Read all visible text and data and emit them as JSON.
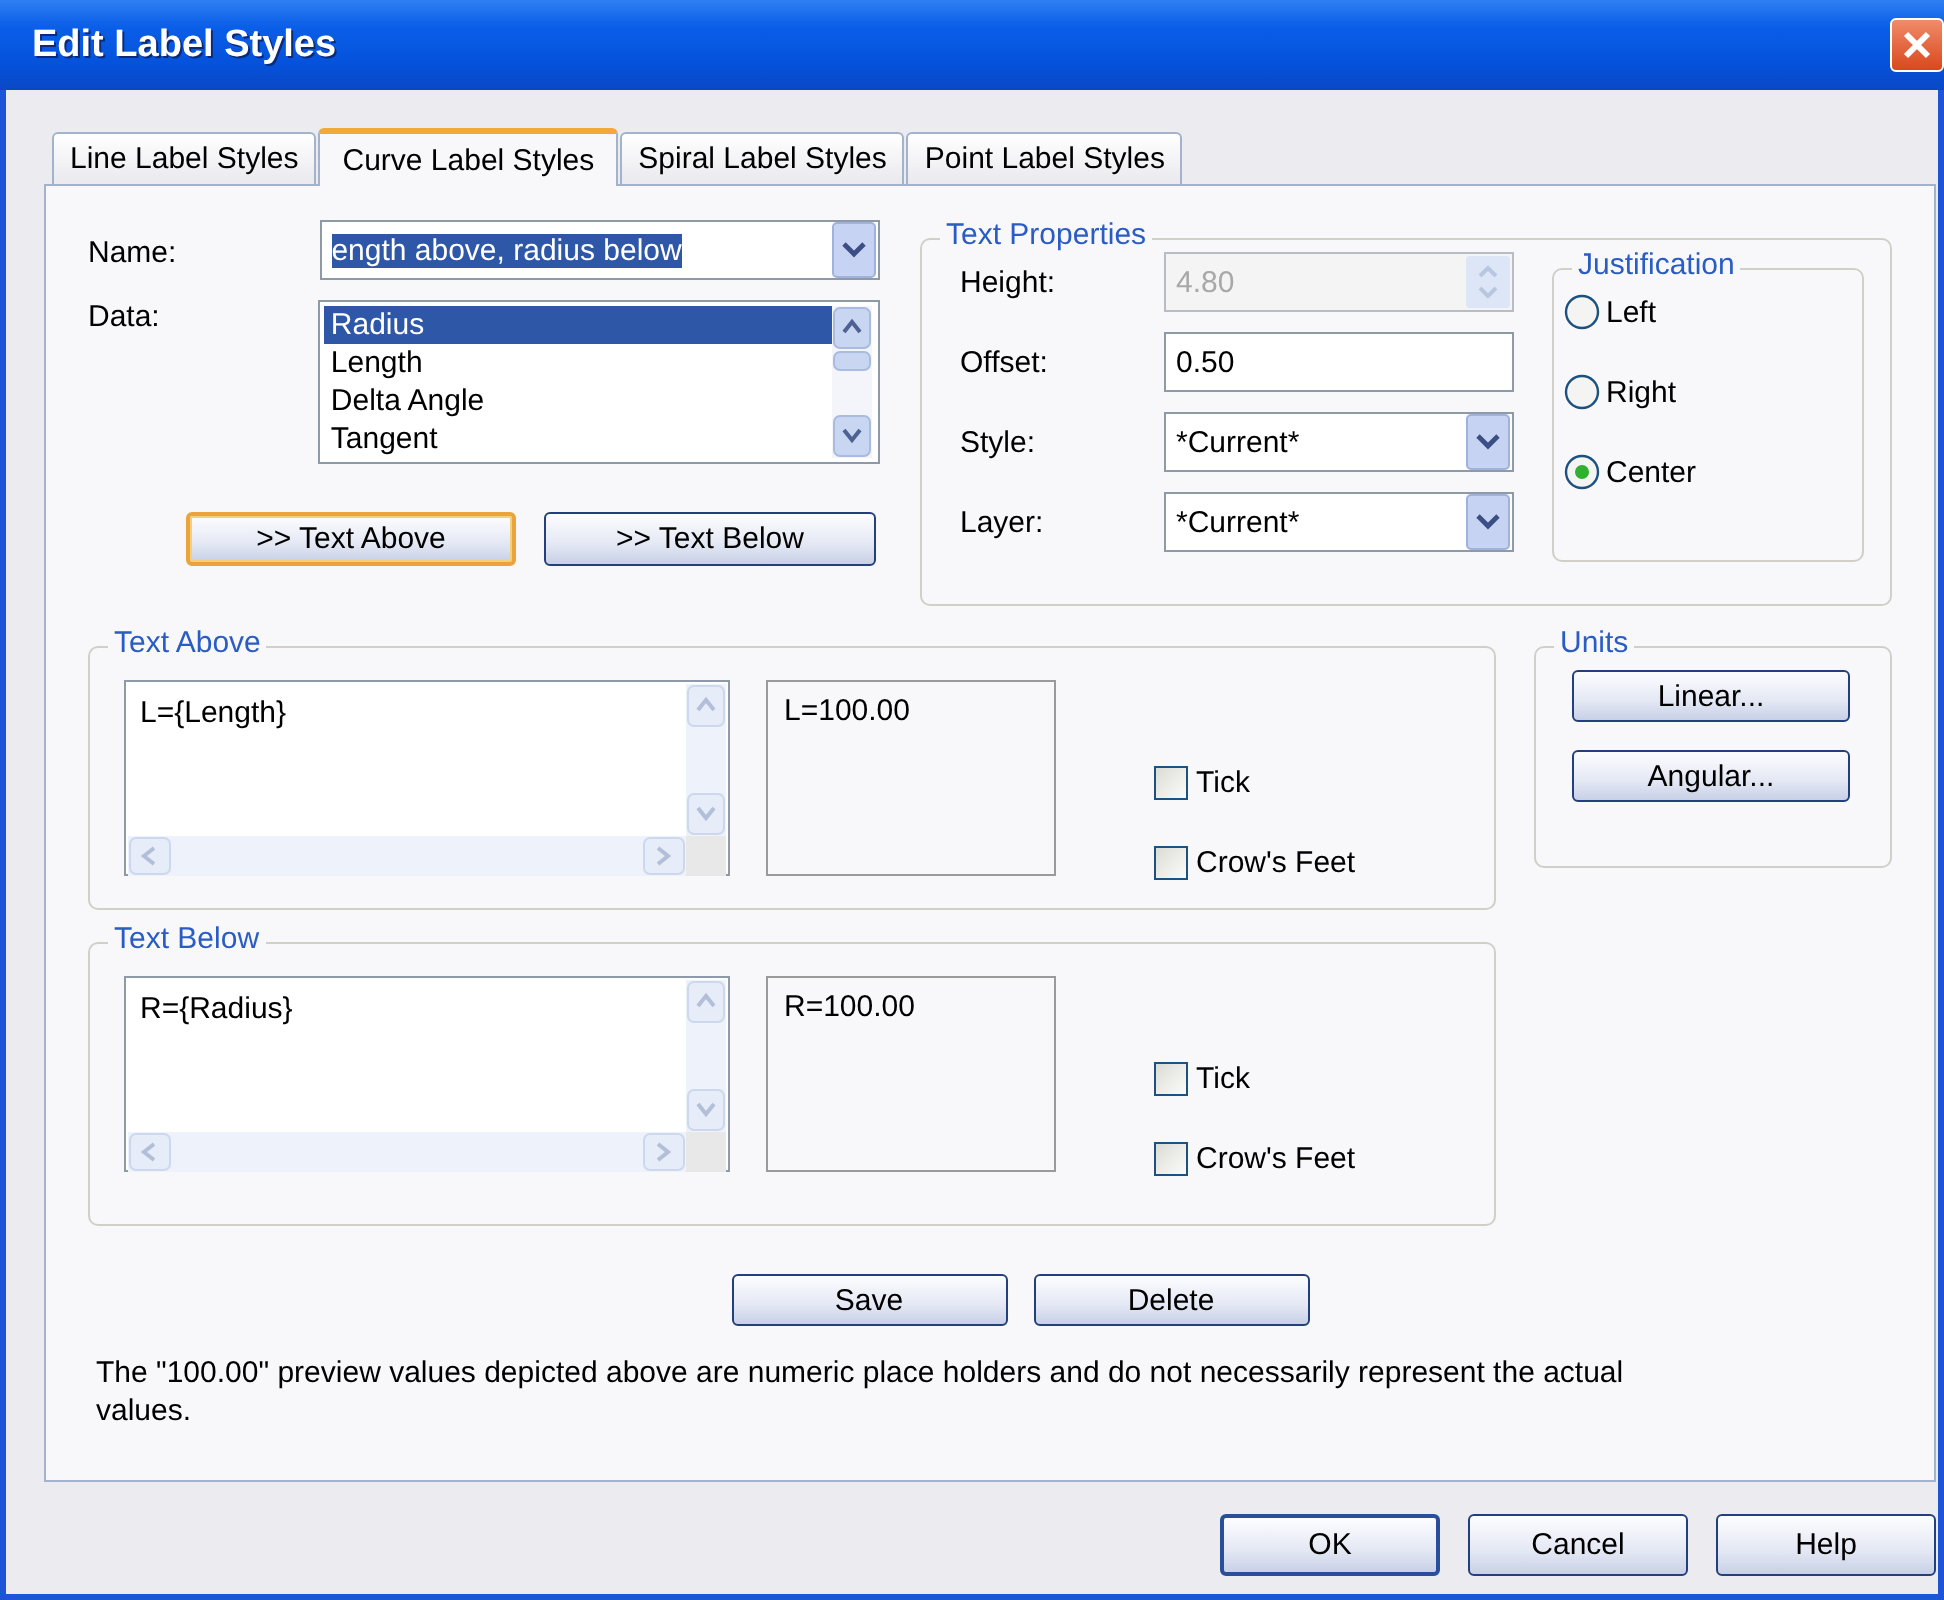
{
  "window": {
    "title": "Edit Label Styles"
  },
  "tabs": [
    {
      "label": "Line Label Styles",
      "selected": false
    },
    {
      "label": "Curve Label Styles",
      "selected": true
    },
    {
      "label": "Spiral Label Styles",
      "selected": false
    },
    {
      "label": "Point Label Styles",
      "selected": false
    }
  ],
  "name_field": {
    "label": "Name:",
    "value": "ength above, radius below"
  },
  "data_list": {
    "label": "Data:",
    "items": [
      {
        "label": "Radius",
        "selected": true
      },
      {
        "label": "Length",
        "selected": false
      },
      {
        "label": "Delta Angle",
        "selected": false
      },
      {
        "label": "Tangent",
        "selected": false
      }
    ]
  },
  "insert_buttons": [
    {
      "label": ">> Text Above",
      "focused": true
    },
    {
      "label": ">> Text Below",
      "focused": false
    }
  ],
  "text_properties": {
    "title": "Text Properties",
    "fields": [
      {
        "kind": "spin",
        "label": "Height:",
        "value": "4.80",
        "disabled": true
      },
      {
        "kind": "text",
        "label": "Offset:",
        "value": "0.50",
        "disabled": false
      },
      {
        "kind": "combo",
        "label": "Style:",
        "value": "*Current*",
        "disabled": false
      },
      {
        "kind": "combo",
        "label": "Layer:",
        "value": "*Current*",
        "disabled": false
      }
    ]
  },
  "justification": {
    "title": "Justification",
    "options": [
      {
        "label": "Left",
        "selected": false
      },
      {
        "label": "Right",
        "selected": false
      },
      {
        "label": "Center",
        "selected": true
      }
    ]
  },
  "sections": [
    {
      "title": "Text Above",
      "format": "L={Length}",
      "preview": "L=100.00",
      "checks": [
        {
          "label": "Tick",
          "checked": false
        },
        {
          "label": "Crow's Feet",
          "checked": false
        }
      ]
    },
    {
      "title": "Text Below",
      "format": "R={Radius}",
      "preview": "R=100.00",
      "checks": [
        {
          "label": "Tick",
          "checked": false
        },
        {
          "label": "Crow's Feet",
          "checked": false
        }
      ]
    }
  ],
  "units": {
    "title": "Units",
    "buttons": [
      "Linear...",
      "Angular..."
    ]
  },
  "actions": [
    "Save",
    "Delete"
  ],
  "note": "The \"100.00\" preview values depicted above are numeric place holders and do not necessarily represent the actual values.",
  "dialog_buttons": [
    {
      "label": "OK",
      "default": true
    },
    {
      "label": "Cancel",
      "default": false
    },
    {
      "label": "Help",
      "default": false
    }
  ]
}
